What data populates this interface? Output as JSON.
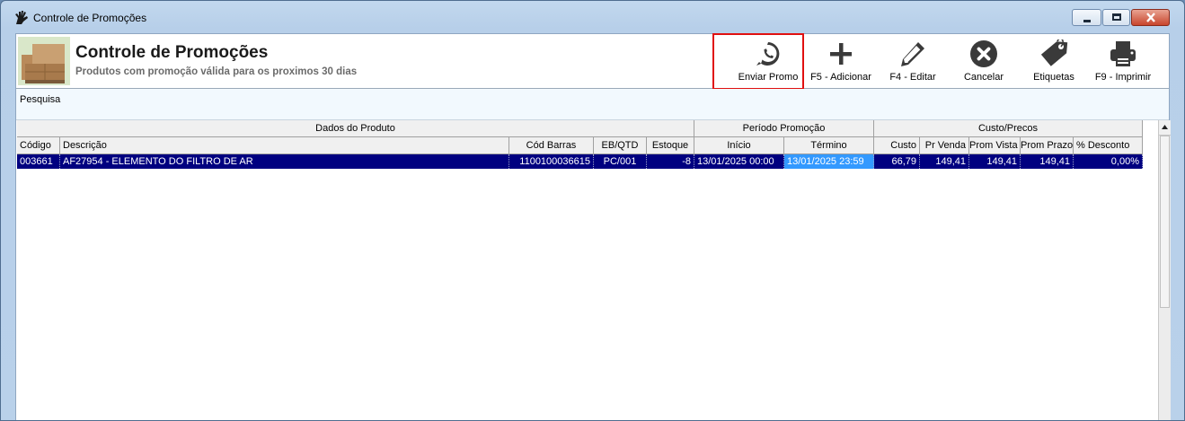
{
  "window": {
    "title": "Controle de Promoções"
  },
  "header": {
    "title": "Controle de Promoções",
    "subtitle": "Produtos com promoção válida para os proximos 30 dias"
  },
  "toolbar": {
    "items": [
      {
        "label": "Enviar Promo",
        "icon": "whatsapp-icon"
      },
      {
        "label": "F5 - Adicionar",
        "icon": "plus-icon"
      },
      {
        "label": "F4 - Editar",
        "icon": "pencil-icon"
      },
      {
        "label": "Cancelar",
        "icon": "cancel-icon"
      },
      {
        "label": "Etiquetas",
        "icon": "tag-icon"
      },
      {
        "label": "F9 - Imprimir",
        "icon": "printer-icon"
      }
    ]
  },
  "search": {
    "label": "Pesquisa"
  },
  "grid": {
    "groups": [
      "Dados do Produto",
      "Período Promoção",
      "Custo/Precos"
    ],
    "columns": [
      "Código",
      "Descrição",
      "Cód Barras",
      "EB/QTD",
      "Estoque",
      "Início",
      "Término",
      "Custo",
      "Pr Venda",
      "Prom Vista",
      "Prom Prazo",
      "% Desconto"
    ],
    "rows": [
      [
        "003661",
        "AF27954 - ELEMENTO DO FILTRO DE AR",
        "1100100036615",
        "PC/001",
        "-8",
        "13/01/2025 00:00",
        "13/01/2025 23:59",
        "66,79",
        "149,41",
        "149,41",
        "149,41",
        "0,00%"
      ]
    ]
  },
  "colors": {
    "selection": "#000080",
    "selected_cell": "#3399ff",
    "highlight_box": "#e01010"
  }
}
